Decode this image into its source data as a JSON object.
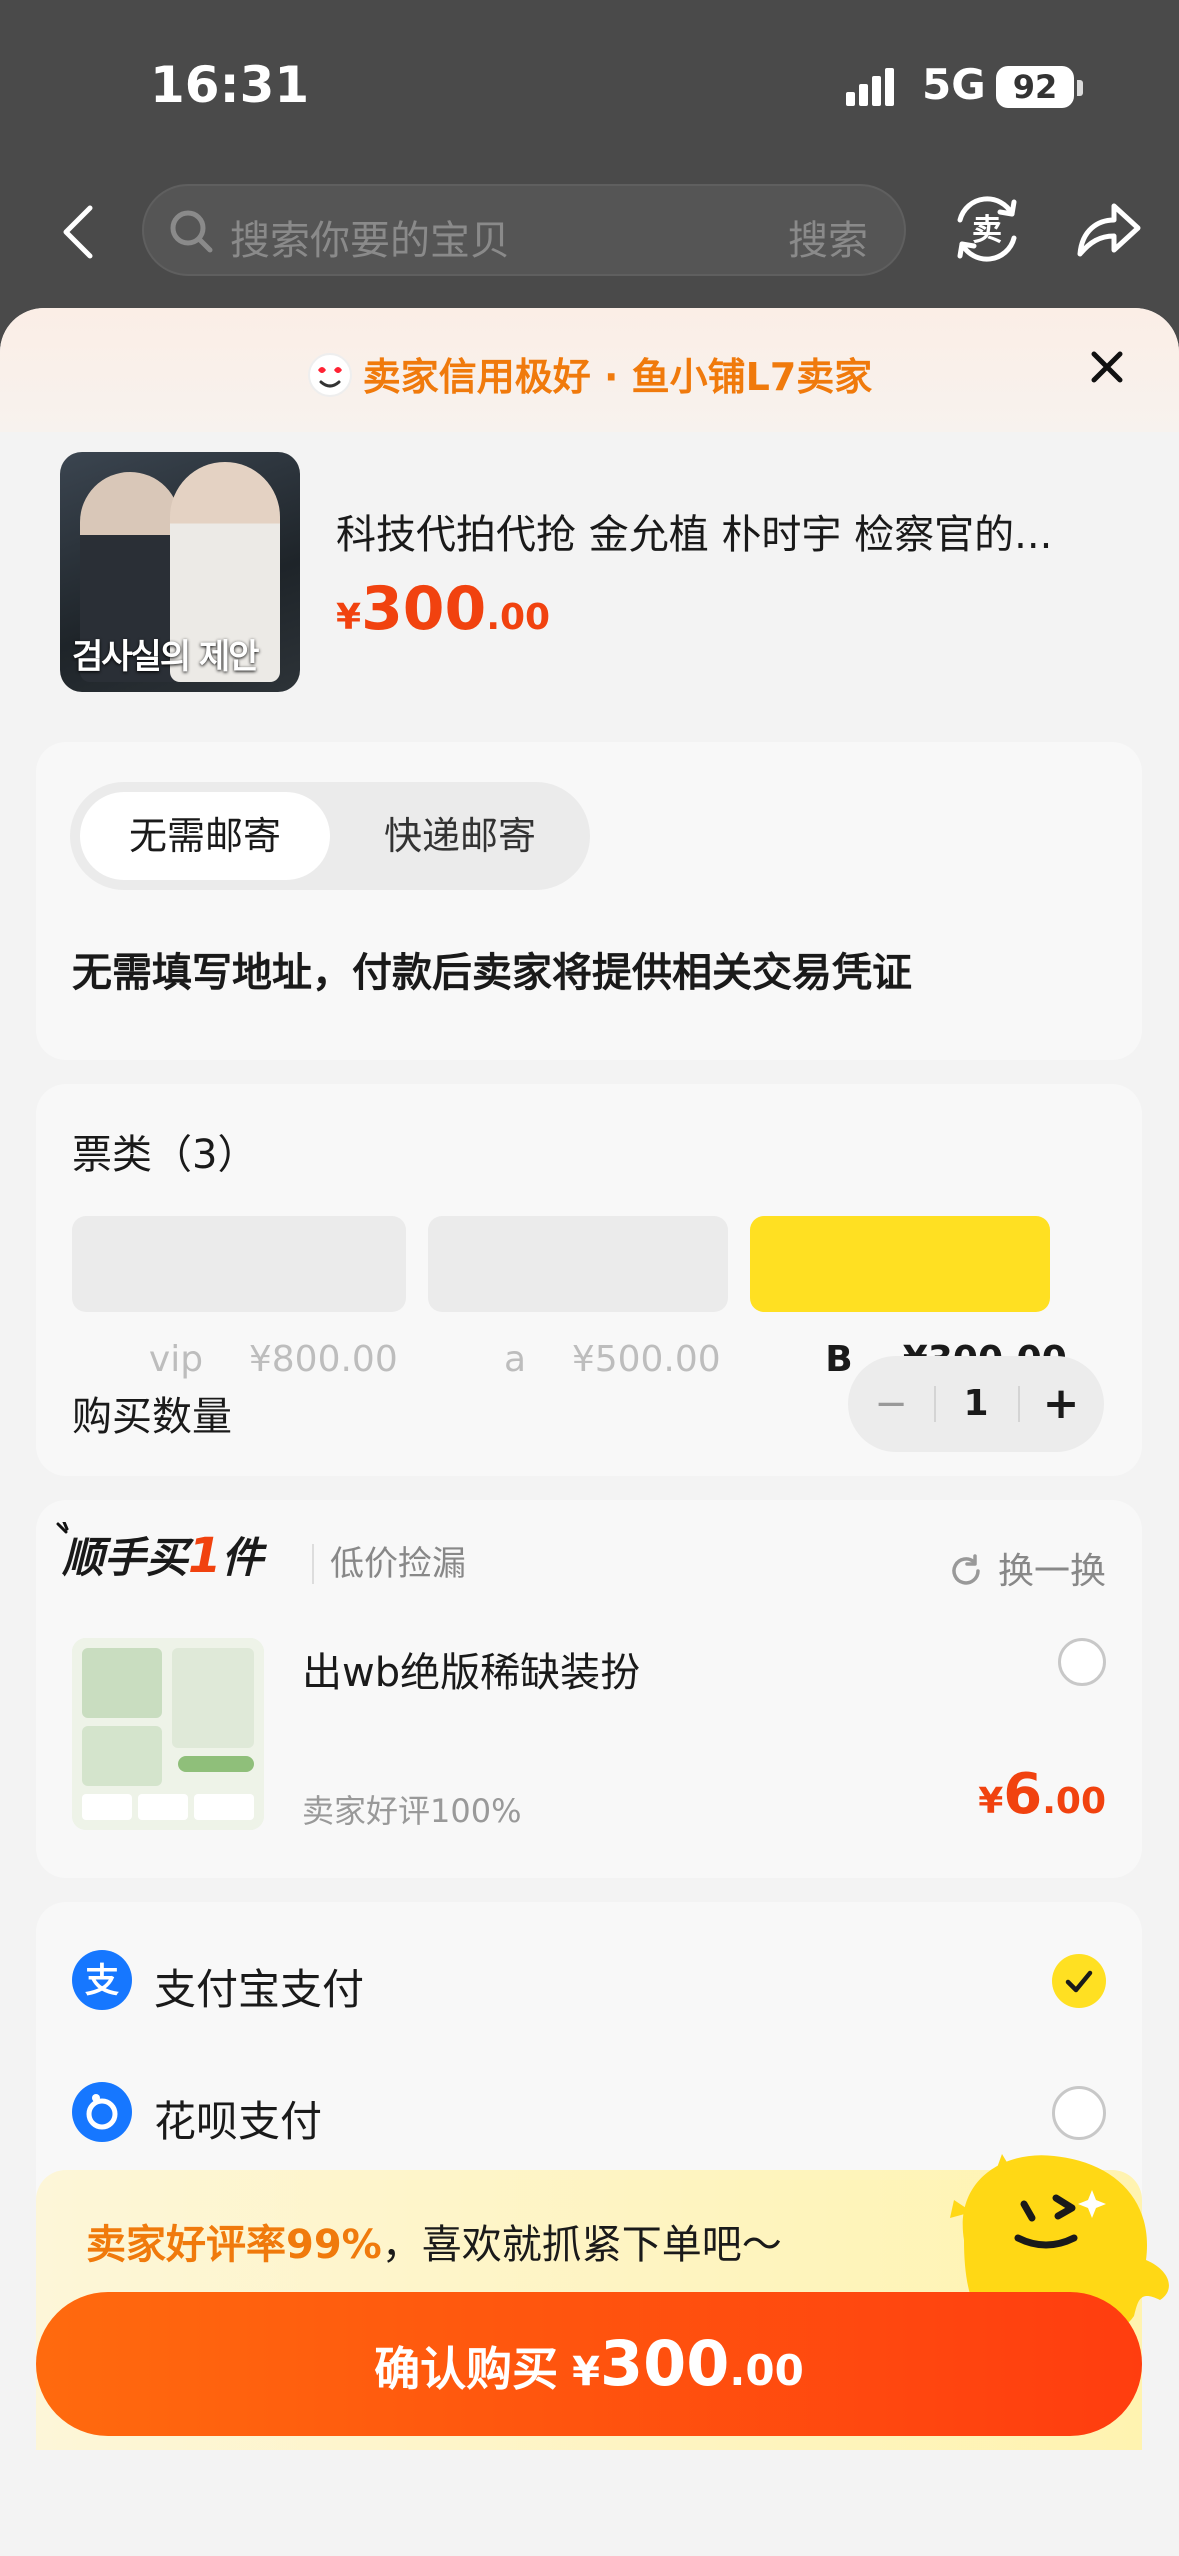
{
  "status": {
    "time": "16:31",
    "network": "5G",
    "battery": "92"
  },
  "nav": {
    "search_placeholder": "搜索你要的宝贝",
    "search_button": "搜索",
    "sell_icon_label": "卖"
  },
  "banner": {
    "text": "卖家信用极好 · 鱼小铺L7卖家"
  },
  "product": {
    "title": "科技代拍代抢 金允植 朴时宇 检察官的...",
    "price_currency": "¥",
    "price_int": "300",
    "price_dec": ".00",
    "thumb_text": "검사실의 제안"
  },
  "shipping": {
    "options": [
      "无需邮寄",
      "快递邮寄"
    ],
    "selected": "无需邮寄",
    "note": "无需填写地址，付款后卖家将提供相关交易凭证"
  },
  "tickets": {
    "label": "票类（3）",
    "options": [
      {
        "name": "vip",
        "price": "¥800.00",
        "selected": false,
        "disabled": true
      },
      {
        "name": "a",
        "price": "¥500.00",
        "selected": false,
        "disabled": true
      },
      {
        "name": "B",
        "price": "¥300.00",
        "selected": true,
        "disabled": false
      }
    ],
    "qty_label": "购买数量",
    "qty": "1",
    "minus": "−",
    "plus": "+"
  },
  "addon": {
    "title_prefix": "顺手买",
    "title_num": "1",
    "title_suffix": "件",
    "subtitle": "低价捡漏",
    "refresh": "换一换",
    "item_name": "出wb绝版稀缺装扮",
    "item_meta": "卖家好评100%",
    "price_currency": "¥",
    "price_int": "6",
    "price_dec": ".00"
  },
  "payment": {
    "methods": [
      {
        "label": "支付宝支付",
        "icon": "alipay-icon",
        "selected": true
      },
      {
        "label": "花呗支付",
        "icon": "huabei-icon",
        "selected": false
      }
    ]
  },
  "promo": {
    "highlight": "卖家好评率99%",
    "rest": "，喜欢就抓紧下单吧～"
  },
  "confirm": {
    "label": "确认购买",
    "currency": "¥",
    "int": "300",
    "dec": ".00"
  },
  "colors": {
    "accent": "#f1420f",
    "yellow": "#ffe022",
    "orange": "#f07a0c"
  }
}
